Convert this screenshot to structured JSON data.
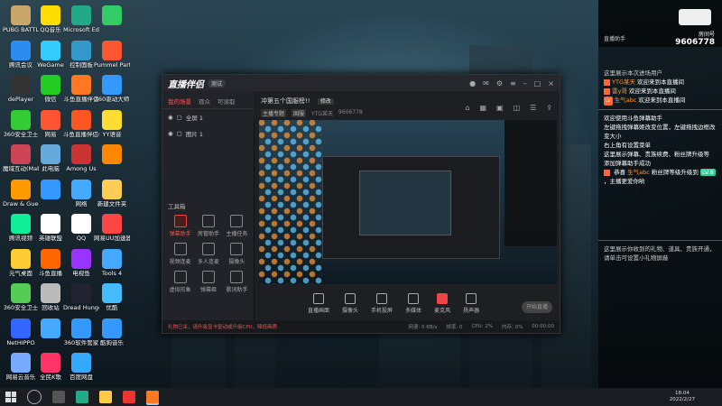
{
  "desktop_icons": [
    {
      "label": "PUBG BATTLEG...",
      "color": "#c9a76b"
    },
    {
      "label": "腾讯会议",
      "color": "#2d8cf0"
    },
    {
      "label": "dePlayer",
      "color": "#333"
    },
    {
      "label": "360安全卫士",
      "color": "#3c3"
    },
    {
      "label": "魔域互动(Mabon...",
      "color": "#c45"
    },
    {
      "label": "Draw & Guess",
      "color": "#f90"
    },
    {
      "label": "腾讯视频",
      "color": "#1e9"
    },
    {
      "label": "元气桌面",
      "color": "#fc3"
    },
    {
      "label": "360安全卫士",
      "color": "#5c5"
    },
    {
      "label": "NetHIPPO",
      "color": "#36f"
    },
    {
      "label": "网易云音乐",
      "color": "#7af"
    },
    {
      "label": "QQ音乐",
      "color": "#fd0"
    },
    {
      "label": "WeGame",
      "color": "#3cf"
    },
    {
      "label": "微信",
      "color": "#2c2"
    },
    {
      "label": "网易",
      "color": "#f53"
    },
    {
      "label": "此电脑",
      "color": "#6ad"
    },
    {
      "label": "",
      "color": "#39f"
    },
    {
      "label": "英雄联盟",
      "color": "#fff"
    },
    {
      "label": "斗鱼直播",
      "color": "#f60"
    },
    {
      "label": "回收站",
      "color": "#bbb"
    },
    {
      "label": "",
      "color": "#4af"
    },
    {
      "label": "全民K歌",
      "color": "#f36"
    },
    {
      "label": "Microsoft Edge",
      "color": "#2a8"
    },
    {
      "label": "控制面板",
      "color": "#39c"
    },
    {
      "label": "斗鱼直播伴侣",
      "color": "#f72"
    },
    {
      "label": "斗鱼直播伴侣(旧)",
      "color": "#f52"
    },
    {
      "label": "Among Us",
      "color": "#c33"
    },
    {
      "label": "网络",
      "color": "#4af"
    },
    {
      "label": "QQ",
      "color": "#fff"
    },
    {
      "label": "电视鱼",
      "color": "#93f"
    },
    {
      "label": "Dread Hunger",
      "color": "#223"
    },
    {
      "label": "360软件管家",
      "color": "#39f"
    },
    {
      "label": "百度网盘",
      "color": "#3af"
    },
    {
      "label": "",
      "color": "#3c6"
    },
    {
      "label": "Pummel Party",
      "color": "#f53"
    },
    {
      "label": "360驱动大师",
      "color": "#39f"
    },
    {
      "label": "YY语音",
      "color": "#fd3"
    },
    {
      "label": "",
      "color": "#f80"
    },
    {
      "label": "新建文件夹",
      "color": "#fc5"
    },
    {
      "label": "网易UU加速器",
      "color": "#f44"
    },
    {
      "label": "Tools 4",
      "color": "#4af"
    },
    {
      "label": "优酷",
      "color": "#4bf"
    },
    {
      "label": "酷狗音乐",
      "color": "#39f"
    }
  ],
  "window": {
    "app_name": "直播伴侣",
    "version": "测试",
    "tabs": [
      "我的场景",
      "观众",
      "可读取"
    ],
    "scenes": [
      "全屏 1",
      "图片 1"
    ],
    "tool_title": "工具箱",
    "tools": [
      {
        "label": "弹幕助手",
        "active": true
      },
      {
        "label": "房管助手",
        "active": false
      },
      {
        "label": "主播任务",
        "active": false
      },
      {
        "label": "视频连麦",
        "active": false
      },
      {
        "label": "多人连麦",
        "active": false
      },
      {
        "label": "摄像头",
        "active": false
      },
      {
        "label": "虚拟形象",
        "active": false
      },
      {
        "label": "弹幕姬",
        "active": false
      },
      {
        "label": "歌词助手",
        "active": false
      }
    ],
    "room_title": "冲第五个国服榜!!",
    "room_title_btn": "修改",
    "room_tags": [
      "主播专题",
      "国服",
      "YTG某天",
      "9606778"
    ],
    "bottom_buttons": [
      {
        "label": "直播画面",
        "kind": "normal"
      },
      {
        "label": "摄像头",
        "kind": "normal"
      },
      {
        "label": "手机投屏",
        "kind": "normal"
      },
      {
        "label": "多媒体",
        "kind": "normal"
      },
      {
        "label": "麦克风",
        "kind": "mic"
      },
      {
        "label": "扬声器",
        "kind": "normal"
      }
    ],
    "start_button": "开始直播",
    "status": {
      "warning": "礼物已关，请升级显卡驱动或升级CPU，降低画质",
      "items": [
        "网速: 0 KB/s",
        "帧率: 0",
        "CPU: 2%",
        "内存: 0%",
        "00:00:00"
      ]
    }
  },
  "chat": {
    "room_label": "房间号",
    "room_number": "9606778",
    "header_label": "直播助手",
    "top_notice": "这里展示本次进场用户",
    "messages": [
      {
        "badge": "",
        "name": "YTG某天",
        "text": " 欢迎来到本直播间"
      },
      {
        "badge": "",
        "name": "雷y哥",
        "text": " 欢迎来到本直播间"
      },
      {
        "badge": "LV",
        "name": "生气abc",
        "text": " 欢迎来到本直播间"
      }
    ],
    "help_lines": [
      "欢迎使用斗鱼弹幕助手",
      "左键拖拽弹幕姬改变位置，左键拖拽边框改变大小",
      "右上角有设置菜单",
      "这里展示弹幕、贵族续费、粉丝牌升级等",
      "添加弹幕助手成功"
    ],
    "upgrade_msg": {
      "prefix": "恭喜 ",
      "name": "生气abc",
      "text": " 粉丝牌等级升级到",
      "level": "LV.8",
      "tail": "，主播更爱你哟"
    },
    "bottom_notice": "这里展示你收到的礼物、道具、贵族开通，请单击可设置小礼物屏蔽"
  },
  "taskbar": {
    "time": "18:04",
    "date": "2022/2/27"
  }
}
